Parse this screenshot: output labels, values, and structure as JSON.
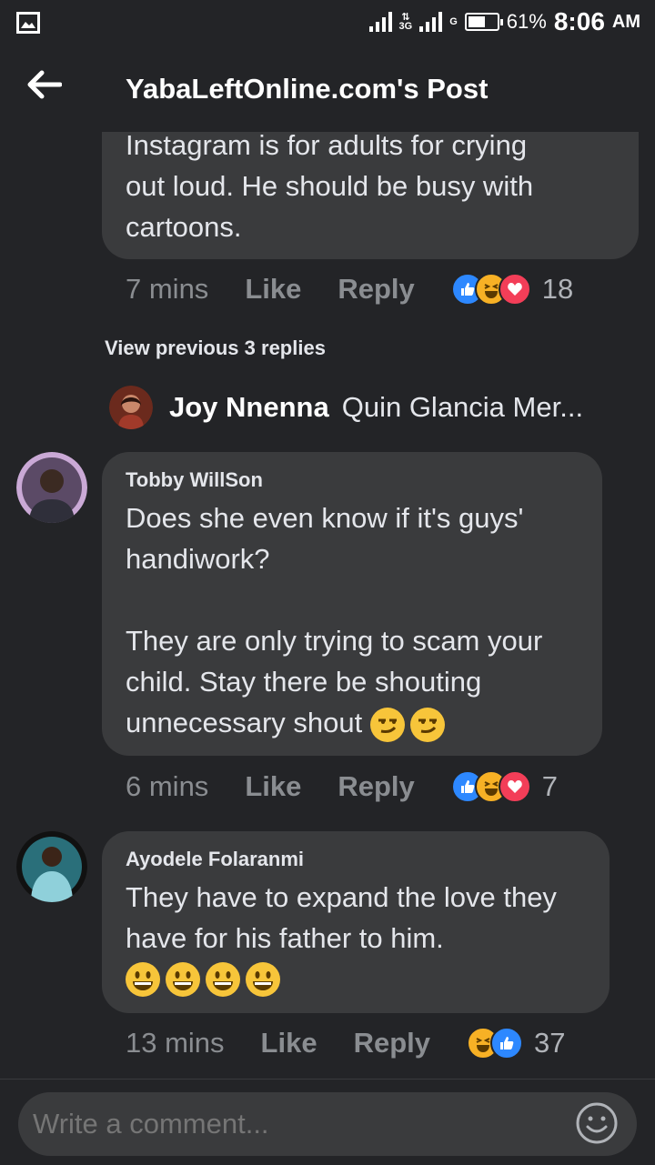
{
  "status_bar": {
    "battery": "61%",
    "time": "8:06",
    "ampm": "AM",
    "network": "3G",
    "network2": "G",
    "battery_level": 0.61
  },
  "header": {
    "title": "YabaLeftOnline.com's Post"
  },
  "comment_top": {
    "text": "Instagram is for adults for crying\nout loud. He should be busy with\ncartoons.",
    "time": "7 mins",
    "like": "Like",
    "reply": "Reply",
    "reaction_count": "18"
  },
  "view_previous": "View previous 3 replies",
  "joy_reply": {
    "name": "Joy Nnenna",
    "text": "Quin Glancia Mer..."
  },
  "comment_tobby": {
    "name": "Tobby WillSon",
    "text": "Does she even know if it's guys'\nhandiwork?\n\nThey are only trying to scam your\nchild. Stay there be shouting\nunnecessary shout",
    "time": "6 mins",
    "like": "Like",
    "reply": "Reply",
    "reaction_count": "7"
  },
  "comment_ayodele": {
    "name": "Ayodele Folaranmi",
    "text": "They have to expand the love they\nhave for his father to him.",
    "time": "13 mins",
    "like": "Like",
    "reply": "Reply",
    "reaction_count": "37"
  },
  "composer": {
    "placeholder": "Write a comment..."
  }
}
